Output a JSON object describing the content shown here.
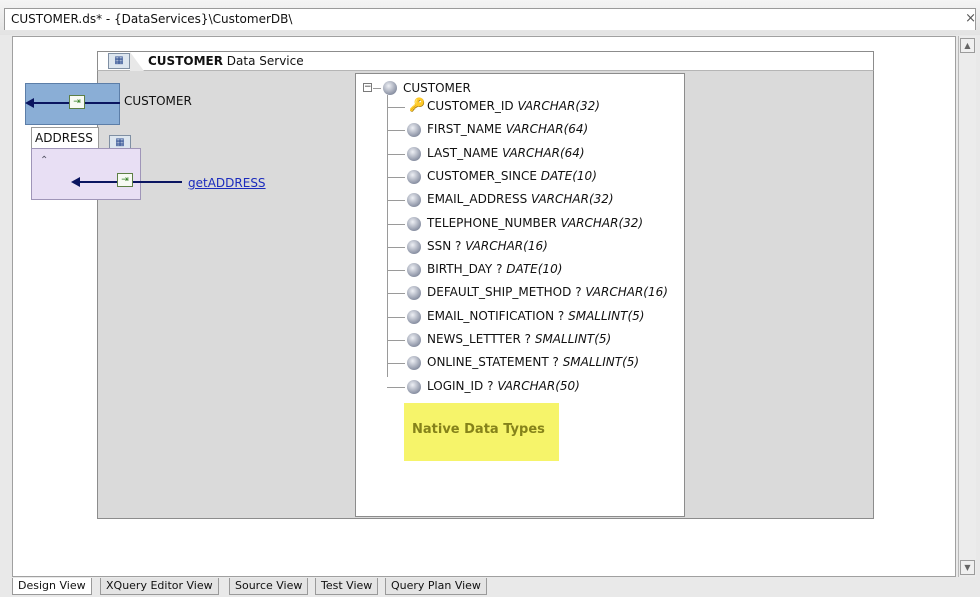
{
  "window": {
    "title": "CUSTOMER.ds* - {DataServices}\\CustomerDB\\",
    "close_glyph": "×"
  },
  "data_service": {
    "name": "CUSTOMER",
    "label": "Data Service"
  },
  "left_panel": {
    "customer_label": "CUSTOMER",
    "address_label": "ADDRESS",
    "get_address_link": "getADDRESS"
  },
  "schema": {
    "root": "CUSTOMER",
    "expander": "−",
    "fields": [
      {
        "name": "CUSTOMER_ID",
        "sep": "",
        "type": "VARCHAR(32)",
        "key": true
      },
      {
        "name": "FIRST_NAME",
        "sep": "",
        "type": "VARCHAR(64)"
      },
      {
        "name": "LAST_NAME",
        "sep": "",
        "type": "VARCHAR(64)"
      },
      {
        "name": "CUSTOMER_SINCE",
        "sep": "",
        "type": "DATE(10)"
      },
      {
        "name": "EMAIL_ADDRESS",
        "sep": "",
        "type": "VARCHAR(32)"
      },
      {
        "name": "TELEPHONE_NUMBER",
        "sep": "",
        "type": "VARCHAR(32)"
      },
      {
        "name": "SSN",
        "sep": "?",
        "type": "VARCHAR(16)"
      },
      {
        "name": "BIRTH_DAY",
        "sep": "?",
        "type": "DATE(10)"
      },
      {
        "name": "DEFAULT_SHIP_METHOD",
        "sep": "?",
        "type": "VARCHAR(16)"
      },
      {
        "name": "EMAIL_NOTIFICATION",
        "sep": "?",
        "type": "SMALLINT(5)"
      },
      {
        "name": "NEWS_LETTTER",
        "sep": "?",
        "type": "SMALLINT(5)"
      },
      {
        "name": "ONLINE_STATEMENT",
        "sep": "?",
        "type": "SMALLINT(5)"
      },
      {
        "name": "LOGIN_ID",
        "sep": "?",
        "type": "VARCHAR(50)"
      }
    ]
  },
  "annotation": "Native Data Types",
  "view_tabs": [
    "Design View",
    "XQuery Editor View",
    "Source View",
    "Test View",
    "Query Plan View"
  ],
  "active_tab": "Design View",
  "colors": {
    "note_bg": "#f6f46a",
    "link": "#1b2bbd",
    "customer_box": "#8aaed6",
    "address_box": "#e8dff4"
  }
}
